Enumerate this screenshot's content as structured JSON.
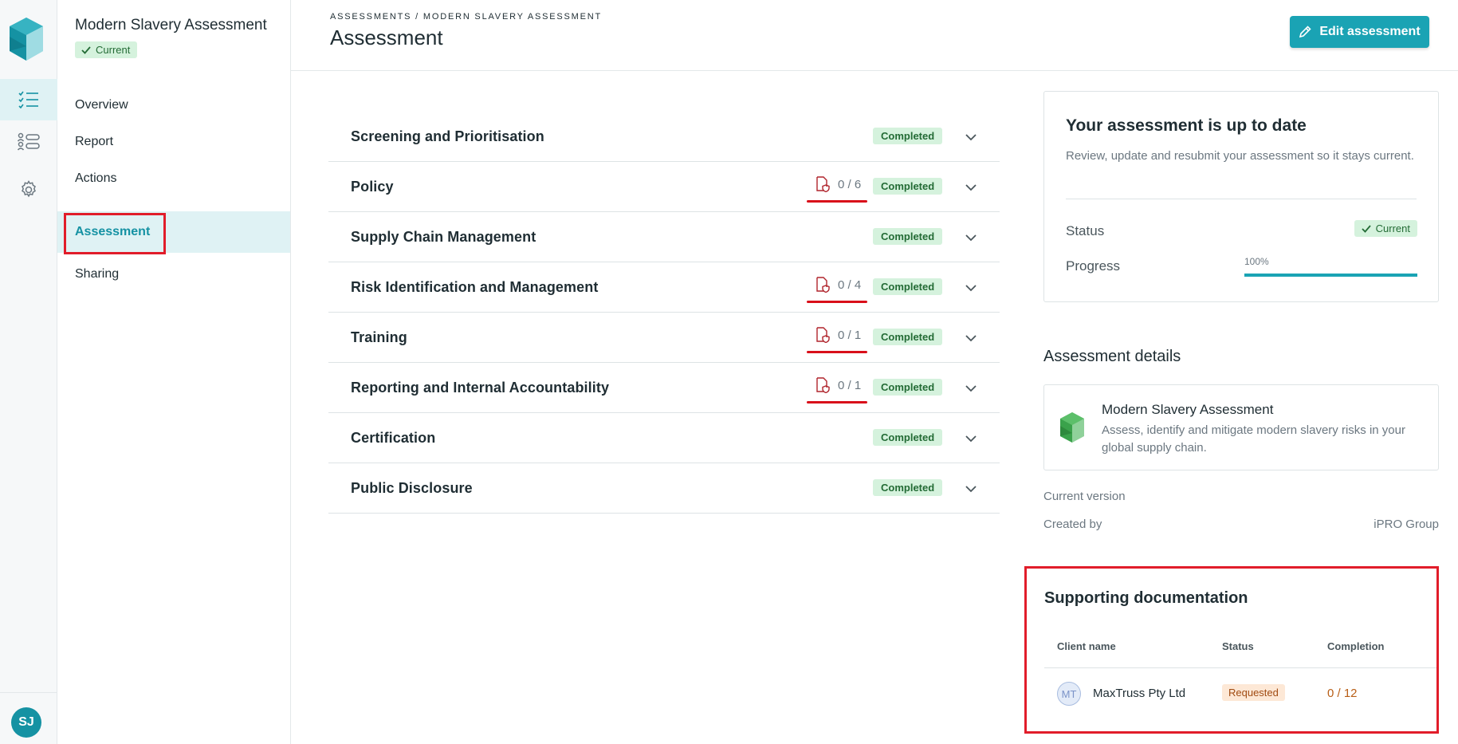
{
  "rail": {
    "avatar_initials": "SJ",
    "icons": [
      "assessments-list-icon",
      "people-list-icon",
      "settings-gear-icon"
    ]
  },
  "subnav": {
    "app_title": "Modern Slavery Assessment",
    "status_badge": "Current",
    "items": [
      {
        "label": "Overview",
        "active": false
      },
      {
        "label": "Report",
        "active": false
      },
      {
        "label": "Actions",
        "active": false
      },
      {
        "label": "Assessment",
        "active": true
      },
      {
        "label": "Sharing",
        "active": false
      }
    ]
  },
  "header": {
    "breadcrumb": "ASSESSMENTS / MODERN SLAVERY ASSESSMENT",
    "title": "Assessment",
    "edit_button": "Edit assessment"
  },
  "sections": [
    {
      "label": "Screening and Prioritisation",
      "status": "Completed",
      "docs": null
    },
    {
      "label": "Policy",
      "status": "Completed",
      "docs": "0 / 6"
    },
    {
      "label": "Supply Chain Management",
      "status": "Completed",
      "docs": null
    },
    {
      "label": "Risk Identification and Management",
      "status": "Completed",
      "docs": "0 / 4"
    },
    {
      "label": "Training",
      "status": "Completed",
      "docs": "0 / 1"
    },
    {
      "label": "Reporting and Internal Accountability",
      "status": "Completed",
      "docs": "0 / 1"
    },
    {
      "label": "Certification",
      "status": "Completed",
      "docs": null
    },
    {
      "label": "Public Disclosure",
      "status": "Completed",
      "docs": null
    }
  ],
  "status_card": {
    "title": "Your assessment is up to date",
    "description": "Review, update and resubmit your assessment so it stays current.",
    "status_label": "Status",
    "status_value": "Current",
    "progress_label": "Progress",
    "progress_text": "100%",
    "progress_fraction": 1.0
  },
  "details": {
    "heading": "Assessment details",
    "name": "Modern Slavery Assessment",
    "description": "Assess, identify and mitigate modern slavery risks in your global supply chain.",
    "current_version_label": "Current version",
    "created_by_label": "Created by",
    "created_by_value": "iPRO Group"
  },
  "supporting": {
    "heading": "Supporting documentation",
    "columns": [
      "Client name",
      "Status",
      "Completion"
    ],
    "rows": [
      {
        "initials": "MT",
        "client": "MaxTruss Pty Ltd",
        "status": "Requested",
        "completion": "0 / 12"
      }
    ]
  },
  "colors": {
    "accent": "#1aa3b4",
    "completed_bg": "#d5f2dd",
    "highlight_red": "#e11d2a",
    "requested_bg": "#fde8d6"
  }
}
